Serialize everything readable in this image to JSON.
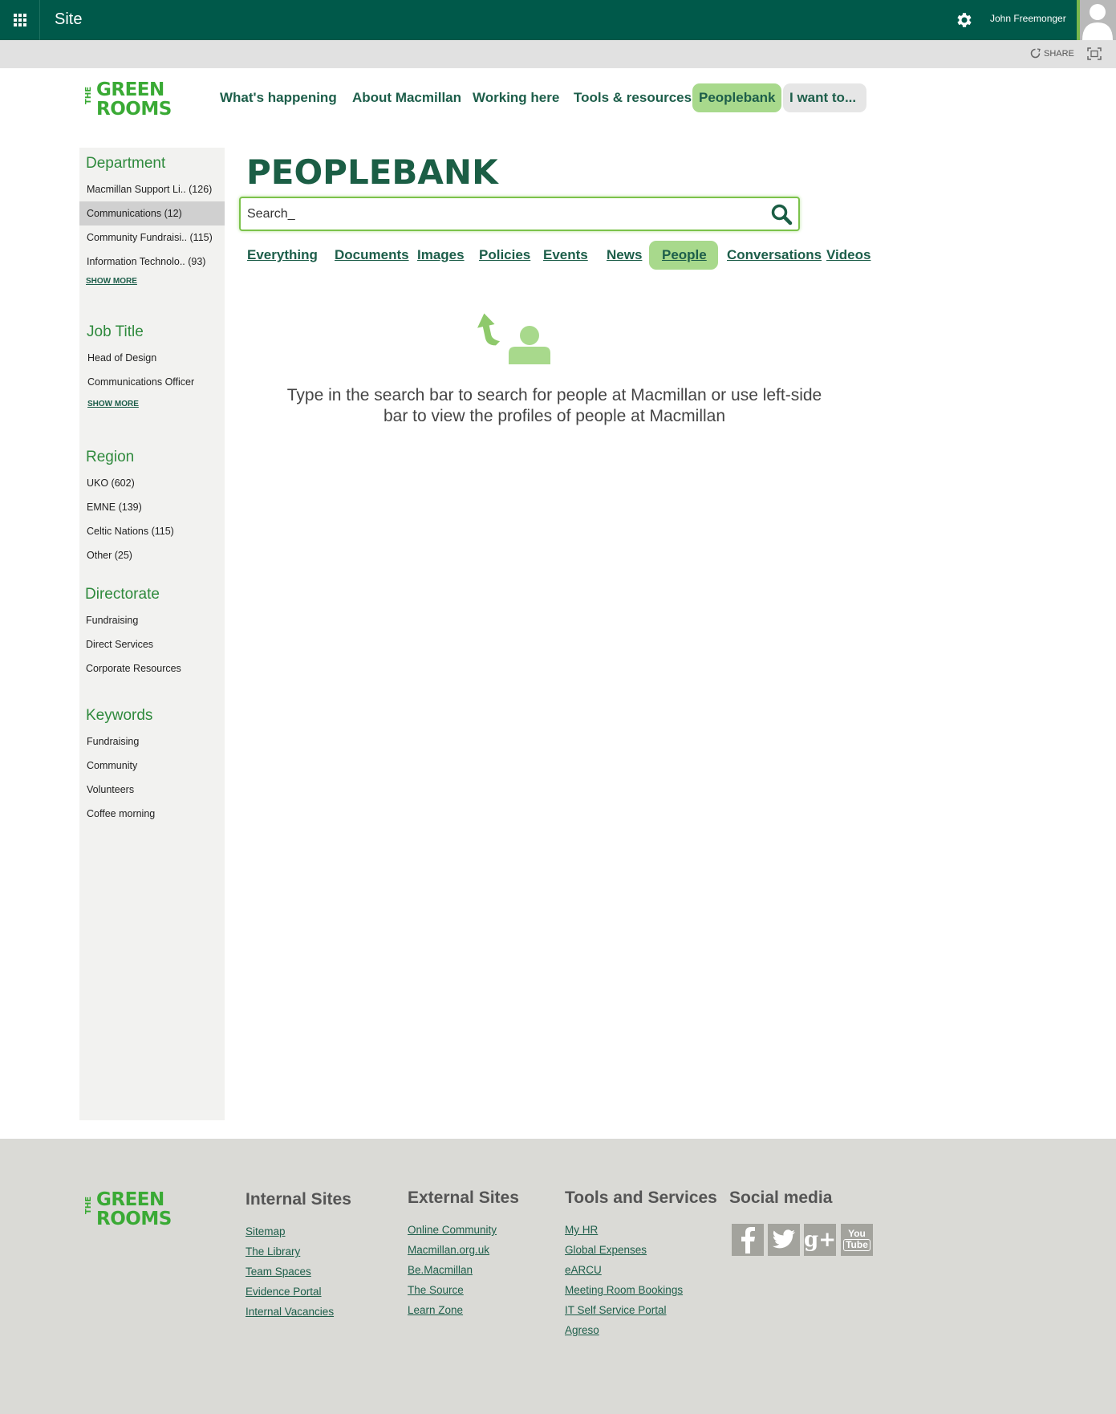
{
  "suite_bar": {
    "site_name": "Site",
    "user_name": "John Freemonger"
  },
  "share_bar": {
    "share_label": "SHARE"
  },
  "logo": {
    "the": "THE",
    "line1": "GREEN",
    "line2": "ROOMS"
  },
  "nav": {
    "items": [
      {
        "label": "What's happening"
      },
      {
        "label": "About Macmillan"
      },
      {
        "label": "Working here"
      },
      {
        "label": "Tools & resources"
      },
      {
        "label": "Peoplebank"
      },
      {
        "label": "I want to..."
      }
    ],
    "active": "Peoplebank"
  },
  "sidebar": {
    "department": {
      "title": "Department",
      "items": [
        {
          "label": "Macmillan Support Li.. (126)"
        },
        {
          "label": "Communications (12)"
        },
        {
          "label": "Community Fundraisi.. (115)"
        },
        {
          "label": "Information Technolo.. (93)"
        }
      ],
      "selected": "Communications (12)",
      "show_more": "SHOW MORE"
    },
    "job_title": {
      "title": "Job Title",
      "items": [
        {
          "label": "Head of Design"
        },
        {
          "label": "Communications Officer"
        }
      ],
      "show_more": "SHOW MORE"
    },
    "region": {
      "title": "Region",
      "items": [
        {
          "label": "UKO (602)"
        },
        {
          "label": "EMNE (139)"
        },
        {
          "label": "Celtic Nations (115)"
        },
        {
          "label": "Other (25)"
        }
      ]
    },
    "directorate": {
      "title": "Directorate",
      "items": [
        {
          "label": "Fundraising"
        },
        {
          "label": "Direct Services"
        },
        {
          "label": "Corporate Resources"
        }
      ]
    },
    "keywords": {
      "title": "Keywords",
      "items": [
        {
          "label": "Fundraising"
        },
        {
          "label": "Community"
        },
        {
          "label": "Volunteers"
        },
        {
          "label": "Coffee morning"
        }
      ]
    }
  },
  "main": {
    "title": "PEOPLEBANK",
    "search": {
      "value": "Search_",
      "placeholder": ""
    },
    "tabs": [
      {
        "label": "Everything"
      },
      {
        "label": "Documents"
      },
      {
        "label": "Images"
      },
      {
        "label": "Policies"
      },
      {
        "label": "Events"
      },
      {
        "label": "News"
      },
      {
        "label": "People"
      },
      {
        "label": "Conversations"
      },
      {
        "label": "Videos"
      }
    ],
    "active_tab": "People",
    "empty_message_line1": "Type in the search bar to search for people at Macmillan or use left-side",
    "empty_message_line2": "bar to view the profiles of people at Macmillan"
  },
  "footer": {
    "internal": {
      "title": "Internal Sites",
      "links": [
        "Sitemap",
        "The Library",
        "Team Spaces",
        "Evidence Portal",
        "Internal Vacancies"
      ]
    },
    "external": {
      "title": "External Sites",
      "links": [
        "Online Community",
        "Macmillan.org.uk",
        "Be.Macmillan",
        "The Source",
        "Learn Zone"
      ]
    },
    "tools": {
      "title": "Tools and Services",
      "links": [
        "My HR",
        "Global Expenses",
        "eARCU",
        "Meeting Room Bookings",
        "IT Self Service Portal",
        "Agreso"
      ]
    },
    "social": {
      "title": "Social media",
      "icons": [
        "facebook-icon",
        "twitter-icon",
        "google-plus-icon",
        "youtube-icon"
      ]
    }
  },
  "colors": {
    "brand_dark": "#00594a",
    "brand_green": "#3aaa35",
    "accent_light": "#a8d98c",
    "footer_bg": "#dadad6"
  }
}
